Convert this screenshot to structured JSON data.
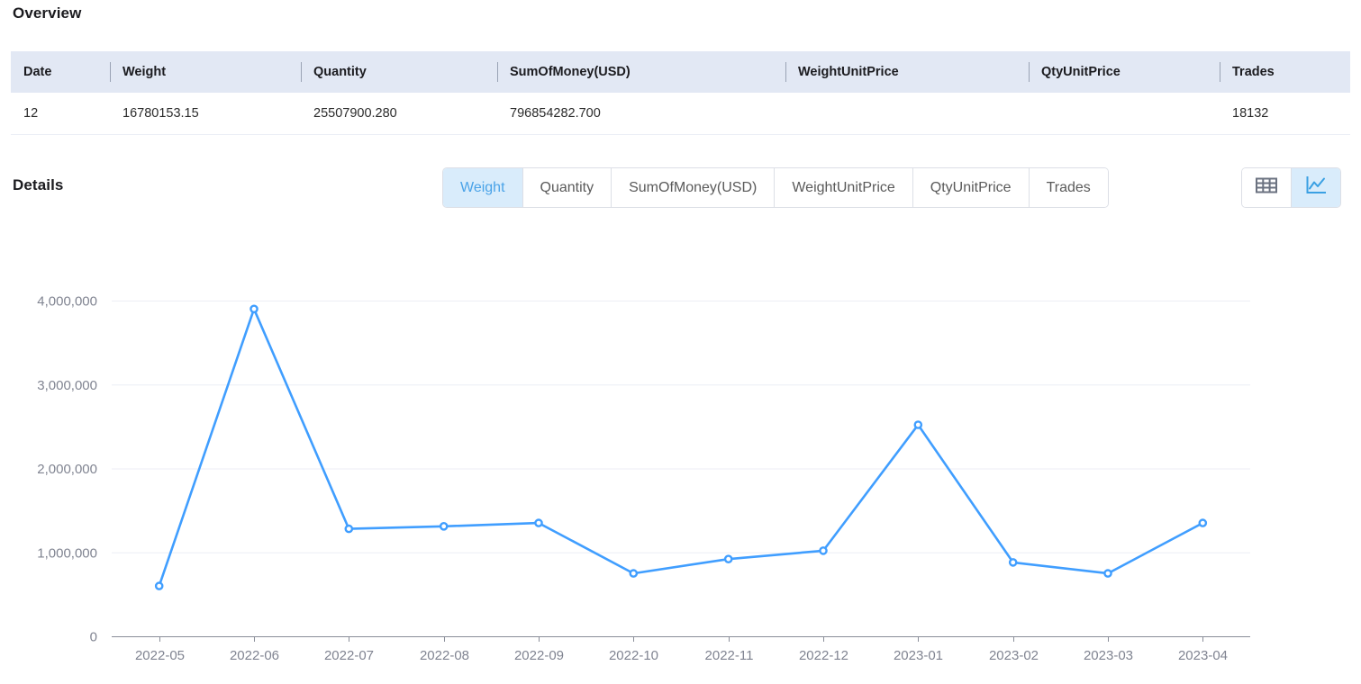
{
  "overview": {
    "title": "Overview",
    "columns": [
      "Date",
      "Weight",
      "Quantity",
      "SumOfMoney(USD)",
      "WeightUnitPrice",
      "QtyUnitPrice",
      "Trades"
    ],
    "rows": [
      {
        "Date": "12",
        "Weight": "16780153.15",
        "Quantity": "25507900.280",
        "SumOfMoney(USD)": "796854282.700",
        "WeightUnitPrice": "",
        "QtyUnitPrice": "",
        "Trades": "18132"
      }
    ],
    "header_bg": "#e2e8f4"
  },
  "details": {
    "title": "Details",
    "metric_tabs": [
      {
        "label": "Weight",
        "active": true
      },
      {
        "label": "Quantity",
        "active": false
      },
      {
        "label": "SumOfMoney(USD)",
        "active": false
      },
      {
        "label": "WeightUnitPrice",
        "active": false
      },
      {
        "label": "QtyUnitPrice",
        "active": false
      },
      {
        "label": "Trades",
        "active": false
      }
    ],
    "view_toggle": [
      {
        "icon": "table-view-icon",
        "active": false
      },
      {
        "icon": "chart-view-icon",
        "active": true
      }
    ],
    "accent_color": "#409eff",
    "active_tab_bg": "#d9ecfb",
    "active_tab_text": "#4aa3e8"
  },
  "chart_data": {
    "type": "line",
    "title": "",
    "xlabel": "",
    "ylabel": "",
    "series_name": "Weight",
    "line_color": "#409eff",
    "grid": true,
    "legend": "none",
    "ylim": [
      0,
      4000000
    ],
    "yticks": [
      0,
      1000000,
      2000000,
      3000000,
      4000000
    ],
    "ytick_labels": [
      "0",
      "1,000,000",
      "2,000,000",
      "3,000,000",
      "4,000,000"
    ],
    "categories": [
      "2022-05",
      "2022-06",
      "2022-07",
      "2022-08",
      "2022-09",
      "2022-10",
      "2022-11",
      "2022-12",
      "2023-01",
      "2023-02",
      "2023-03",
      "2023-04"
    ],
    "values": [
      600000,
      3900000,
      1280000,
      1310000,
      1350000,
      750000,
      920000,
      1020000,
      2520000,
      880000,
      750000,
      1350000
    ]
  }
}
